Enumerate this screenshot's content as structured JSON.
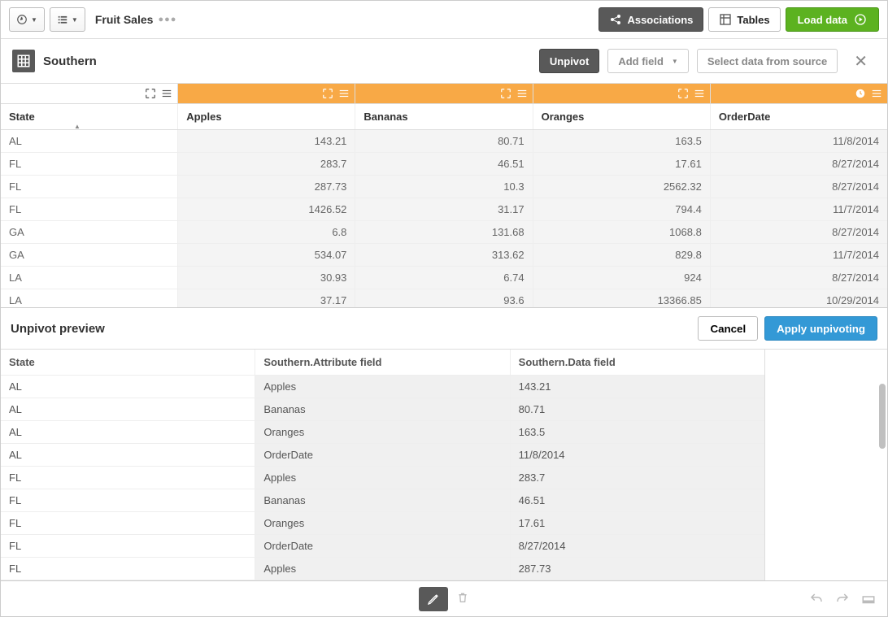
{
  "top": {
    "tableName": "Fruit Sales",
    "associations": "Associations",
    "tables": "Tables",
    "loadData": "Load data"
  },
  "sub": {
    "title": "Southern",
    "unpivot": "Unpivot",
    "addField": "Add field",
    "selectSource": "Select data from source"
  },
  "columns": [
    "State",
    "Apples",
    "Bananas",
    "Oranges",
    "OrderDate"
  ],
  "rows": [
    {
      "state": "AL",
      "apples": "143.21",
      "bananas": "80.71",
      "oranges": "163.5",
      "date": "11/8/2014"
    },
    {
      "state": "FL",
      "apples": "283.7",
      "bananas": "46.51",
      "oranges": "17.61",
      "date": "8/27/2014"
    },
    {
      "state": "FL",
      "apples": "287.73",
      "bananas": "10.3",
      "oranges": "2562.32",
      "date": "8/27/2014"
    },
    {
      "state": "FL",
      "apples": "1426.52",
      "bananas": "31.17",
      "oranges": "794.4",
      "date": "11/7/2014"
    },
    {
      "state": "GA",
      "apples": "6.8",
      "bananas": "131.68",
      "oranges": "1068.8",
      "date": "8/27/2014"
    },
    {
      "state": "GA",
      "apples": "534.07",
      "bananas": "313.62",
      "oranges": "829.8",
      "date": "11/7/2014"
    },
    {
      "state": "LA",
      "apples": "30.93",
      "bananas": "6.74",
      "oranges": "924",
      "date": "8/27/2014"
    },
    {
      "state": "LA",
      "apples": "37.17",
      "bananas": "93.6",
      "oranges": "13366.85",
      "date": "10/29/2014"
    }
  ],
  "preview": {
    "title": "Unpivot preview",
    "cancel": "Cancel",
    "apply": "Apply unpivoting",
    "headers": [
      "State",
      "Southern.Attribute field",
      "Southern.Data field"
    ],
    "rows": [
      [
        "AL",
        "Apples",
        "143.21"
      ],
      [
        "AL",
        "Bananas",
        "80.71"
      ],
      [
        "AL",
        "Oranges",
        "163.5"
      ],
      [
        "AL",
        "OrderDate",
        "11/8/2014"
      ],
      [
        "FL",
        "Apples",
        "283.7"
      ],
      [
        "FL",
        "Bananas",
        "46.51"
      ],
      [
        "FL",
        "Oranges",
        "17.61"
      ],
      [
        "FL",
        "OrderDate",
        "8/27/2014"
      ],
      [
        "FL",
        "Apples",
        "287.73"
      ]
    ]
  }
}
